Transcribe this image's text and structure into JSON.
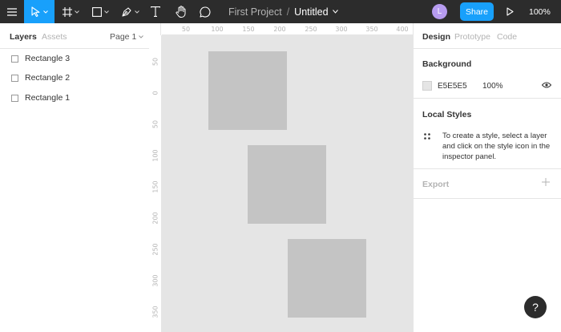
{
  "toolbar": {
    "project": "First Project",
    "separator": "/",
    "file": "Untitled",
    "avatar": "L",
    "share": "Share",
    "zoom": "100%",
    "icons": [
      "menu-icon",
      "move-icon",
      "frame-icon",
      "rectangle-icon",
      "pen-icon",
      "text-icon",
      "hand-icon",
      "comment-icon",
      "play-icon"
    ]
  },
  "left_panel": {
    "tabs": [
      "Layers",
      "Assets"
    ],
    "page": "Page 1",
    "layers": [
      "Rectangle 3",
      "Rectangle 2",
      "Rectangle 1"
    ]
  },
  "rulers": {
    "top": [
      "50",
      "100",
      "150",
      "200",
      "250",
      "300",
      "350",
      "400"
    ],
    "left": [
      "50",
      "0",
      "50",
      "100",
      "150",
      "200",
      "250",
      "300",
      "350"
    ]
  },
  "right_panel": {
    "tabs": [
      "Design",
      "Prototype",
      "Code"
    ],
    "background": {
      "title": "Background",
      "hex": "E5E5E5",
      "opacity": "100%"
    },
    "local_styles": {
      "title": "Local Styles",
      "text": "To create a style, select a layer and click on the style icon in the inspector panel."
    },
    "export": {
      "title": "Export"
    }
  },
  "help": "?",
  "colors": {
    "toolbar": "#2c2c2c",
    "accent": "#18a0fb",
    "canvas": "#e5e5e5",
    "shape": "#c4c4c4",
    "avatar": "#b79cf0"
  }
}
